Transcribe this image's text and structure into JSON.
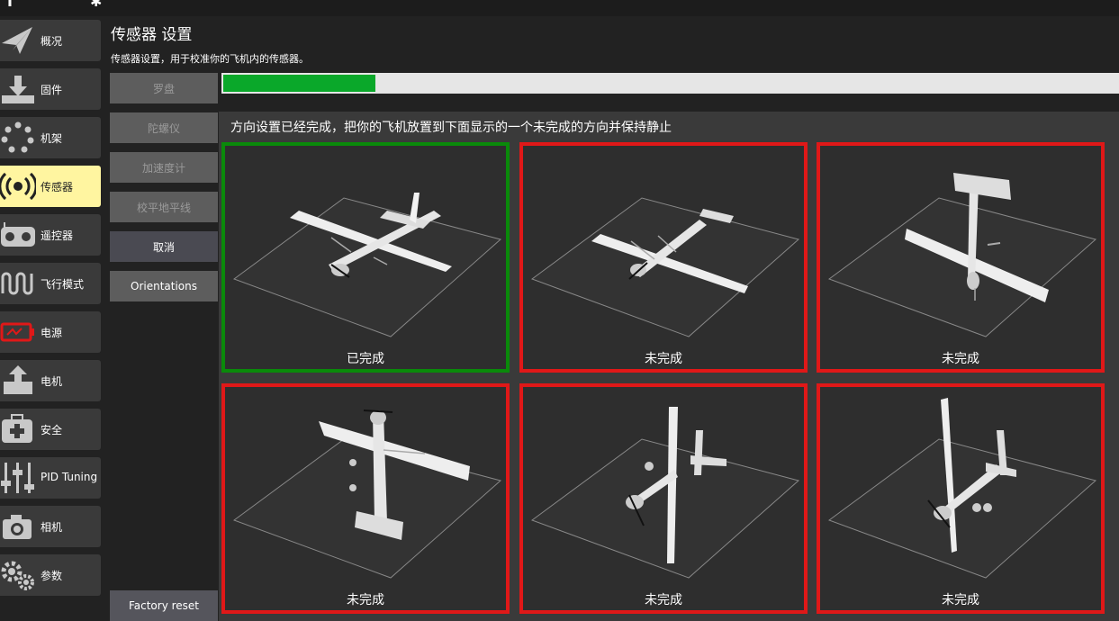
{
  "page": {
    "title": "传感器 设置",
    "subtitle": "传感器设置，用于校准你的飞机内的传感器。"
  },
  "colors": {
    "accent_active": "#fff5a0",
    "progress": "#0aa82a",
    "done_border": "#0a8a0a",
    "pending_border": "#e01818"
  },
  "sidebar": {
    "items": [
      {
        "label": "概况",
        "icon": "paper-plane-icon"
      },
      {
        "label": "固件",
        "icon": "download-icon"
      },
      {
        "label": "机架",
        "icon": "frame-dots-icon"
      },
      {
        "label": "传感器",
        "icon": "radio-waves-icon",
        "active": true
      },
      {
        "label": "遥控器",
        "icon": "remote-controller-icon"
      },
      {
        "label": "飞行模式",
        "icon": "flight-mode-wave-icon"
      },
      {
        "label": "电源",
        "icon": "battery-icon"
      },
      {
        "label": "电机",
        "icon": "motor-icon"
      },
      {
        "label": "安全",
        "icon": "first-aid-icon"
      },
      {
        "label": "PID Tuning",
        "icon": "sliders-icon"
      },
      {
        "label": "相机",
        "icon": "camera-icon"
      },
      {
        "label": "参数",
        "icon": "gears-icon"
      }
    ]
  },
  "calibration": {
    "buttons": [
      {
        "label": "罗盘",
        "enabled": false
      },
      {
        "label": "陀螺仪",
        "enabled": false
      },
      {
        "label": "加速度计",
        "enabled": false
      },
      {
        "label": "校平地平线",
        "enabled": false
      },
      {
        "label": "取消",
        "enabled": true
      },
      {
        "label": "Orientations",
        "enabled": true
      }
    ],
    "factory_reset_label": "Factory reset",
    "progress_fraction": 0.17
  },
  "orientation": {
    "instruction": "方向设置已经完成，把你的飞机放置到下面显示的一个未完成的方向并保持静止",
    "tiles": [
      {
        "status": "已完成",
        "done": true,
        "pose": "level"
      },
      {
        "status": "未完成",
        "done": false,
        "pose": "upside-down"
      },
      {
        "status": "未完成",
        "done": false,
        "pose": "nose-down"
      },
      {
        "status": "未完成",
        "done": false,
        "pose": "nose-up"
      },
      {
        "status": "未完成",
        "done": false,
        "pose": "left-side"
      },
      {
        "status": "未完成",
        "done": false,
        "pose": "right-side"
      }
    ]
  }
}
